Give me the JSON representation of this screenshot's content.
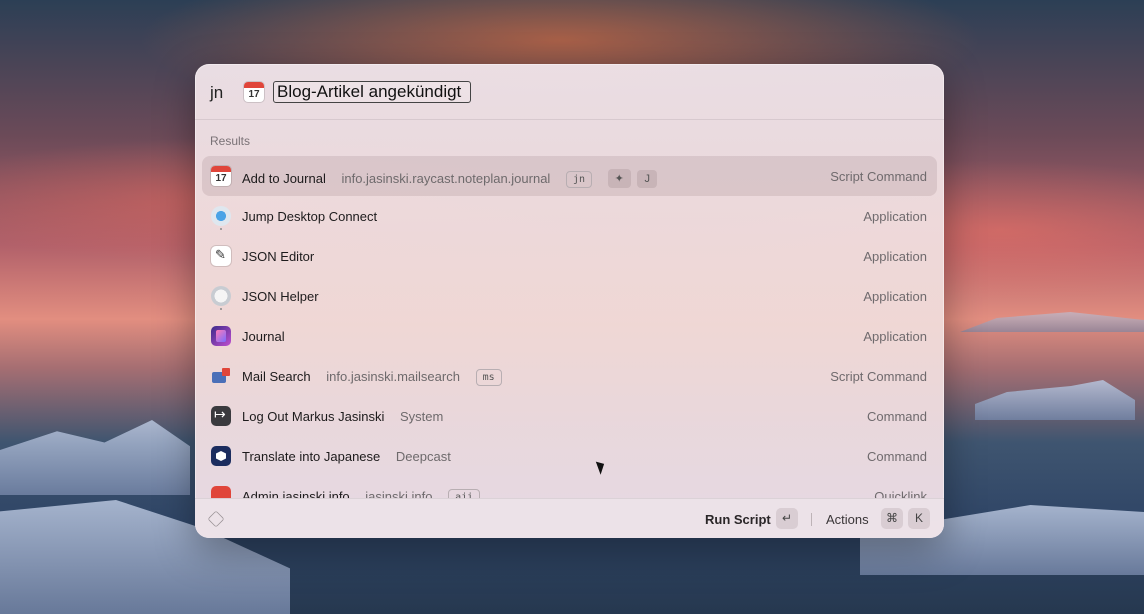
{
  "search": {
    "prefix": "jn",
    "query": "Blog-Artikel angekündigt",
    "calendar_day": "17"
  },
  "results_section": "Results",
  "results": [
    {
      "title": "Add to Journal",
      "subtitle": "info.jasinski.raycast.noteplan.journal",
      "alias": "jn",
      "hotkey": [
        "✦",
        "J"
      ],
      "kind": "Script Command",
      "icon": "calendar-icon",
      "selected": true
    },
    {
      "title": "Jump Desktop Connect",
      "subtitle": "",
      "kind": "Application",
      "icon": "jump-desktop-icon"
    },
    {
      "title": "JSON Editor",
      "subtitle": "",
      "kind": "Application",
      "icon": "json-editor-icon"
    },
    {
      "title": "JSON Helper",
      "subtitle": "",
      "kind": "Application",
      "icon": "json-helper-icon"
    },
    {
      "title": "Journal",
      "subtitle": "",
      "kind": "Application",
      "icon": "journal-icon"
    },
    {
      "title": "Mail Search",
      "subtitle": "info.jasinski.mailsearch",
      "alias": "ms",
      "kind": "Script Command",
      "icon": "mailbox-icon"
    },
    {
      "title": "Log Out Markus Jasinski",
      "subtitle": "System",
      "kind": "Command",
      "icon": "logout-icon"
    },
    {
      "title": "Translate into Japanese",
      "subtitle": "Deepcast",
      "kind": "Command",
      "icon": "deepcast-icon"
    },
    {
      "title": "Admin jasinski.info",
      "subtitle": "jasinski.info",
      "alias": "aji",
      "kind": "Quicklink",
      "icon": "link-icon"
    }
  ],
  "footer": {
    "primary_action": "Run Script",
    "primary_key": "↵",
    "actions_label": "Actions",
    "actions_keys": [
      "⌘",
      "K"
    ]
  }
}
